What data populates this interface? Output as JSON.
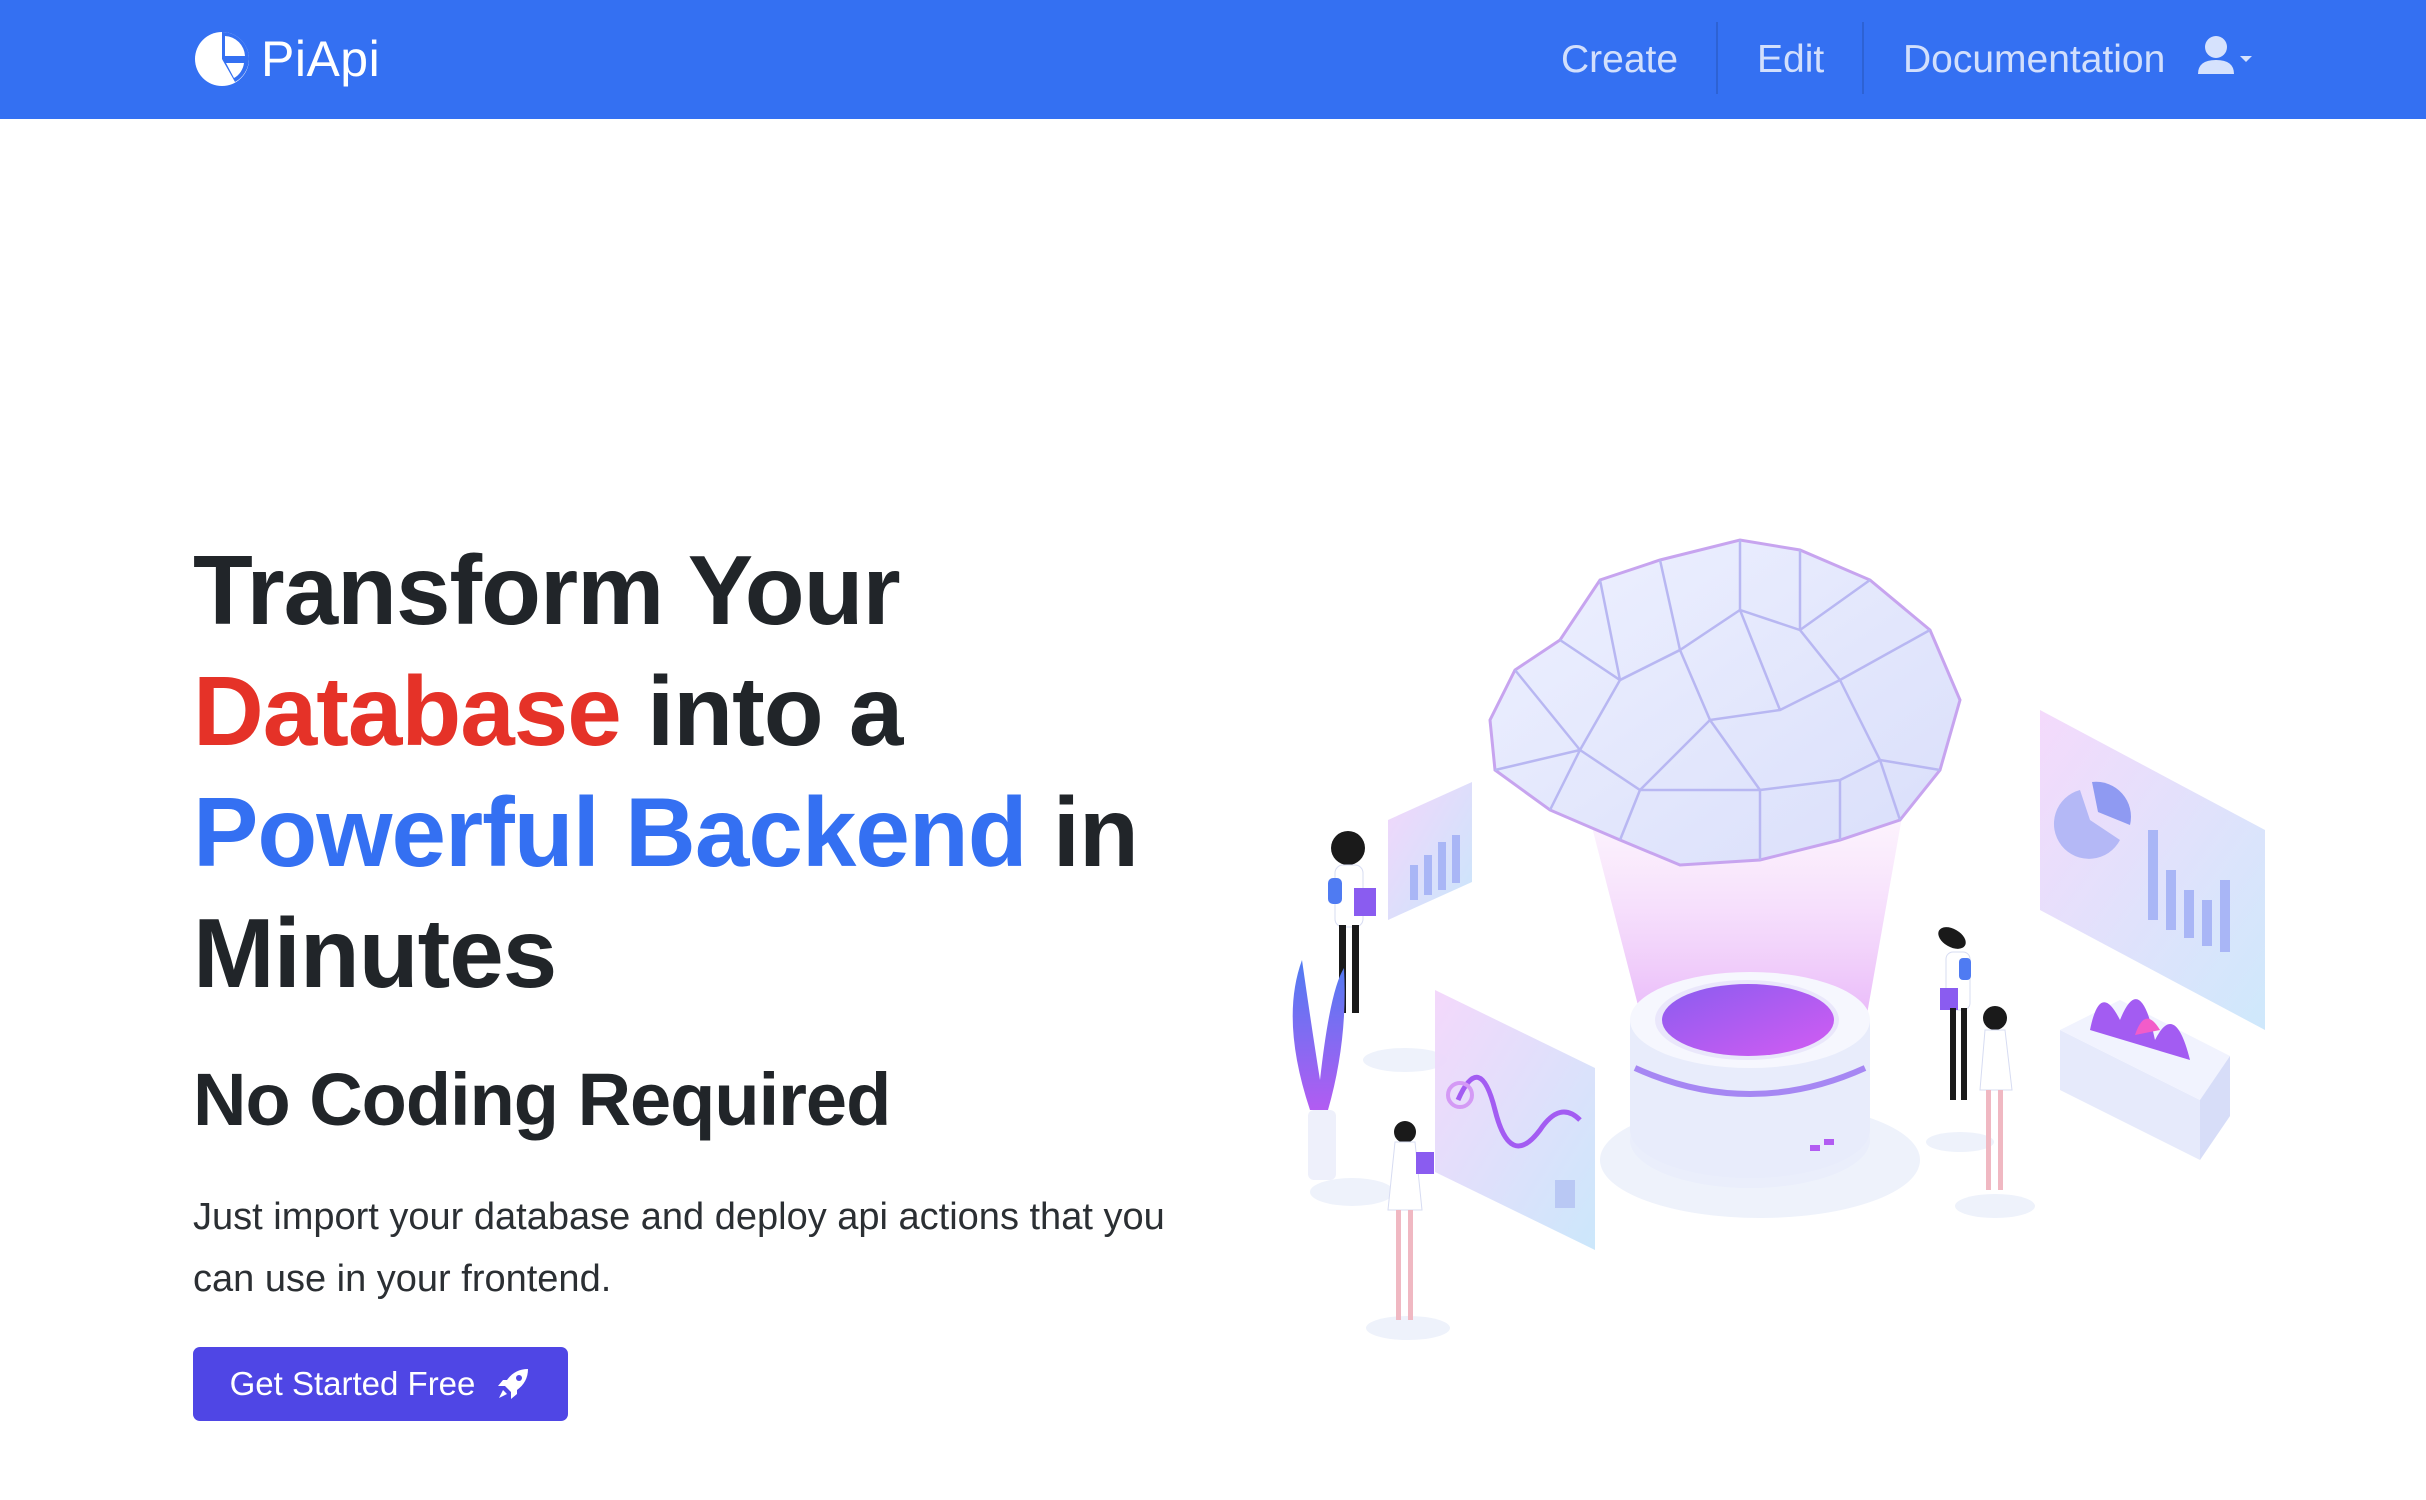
{
  "brand": {
    "name": "PiApi",
    "icon": "pie-chart-icon"
  },
  "nav": {
    "links": [
      {
        "label": "Create"
      },
      {
        "label": "Edit"
      },
      {
        "label": "Documentation"
      }
    ],
    "user_icon": "user-icon",
    "dropdown_icon": "caret-down-icon"
  },
  "hero": {
    "title_part1": "Transform Your",
    "title_highlight_red": "Database",
    "title_part2": " into a",
    "title_highlight_blue": "Powerful Backend",
    "title_part3": " in",
    "title_part4": "Minutes",
    "subtitle": "No Coding Required",
    "description": "Just import your database and deploy api actions that you can use in your frontend.",
    "cta_label": "Get Started Free",
    "cta_icon": "rocket-icon"
  },
  "colors": {
    "navbar": "#3470F2",
    "highlight_red": "#E53228",
    "highlight_blue": "#3470F2",
    "cta": "#4F46E5"
  }
}
